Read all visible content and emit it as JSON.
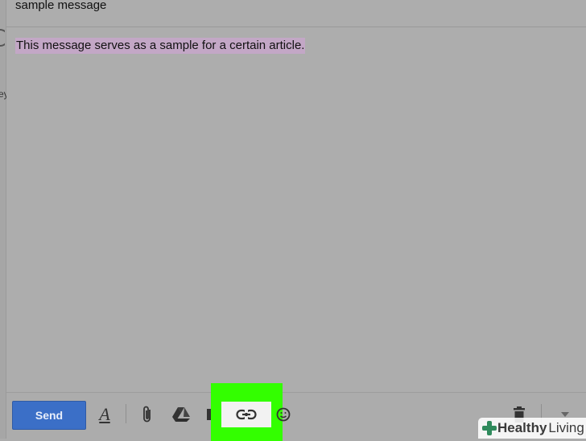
{
  "compose": {
    "subject": "sample message",
    "body_selected_text": "This message serves as a sample for a certain article.",
    "highlight_color": "#c3a7c6"
  },
  "toolbar": {
    "send_label": "Send",
    "send_color": "#3b6fc7",
    "format_glyph": "A",
    "icons": [
      "format-text-icon",
      "attach-icon",
      "drive-icon",
      "photo-icon",
      "insert-link-icon",
      "emoji-icon",
      "trash-icon",
      "more-options-icon"
    ]
  },
  "callout": {
    "color": "#33ff00"
  },
  "watermark": {
    "word1": "Healthy",
    "word2": "Living"
  },
  "left_strip": {
    "fragment": "ey"
  }
}
